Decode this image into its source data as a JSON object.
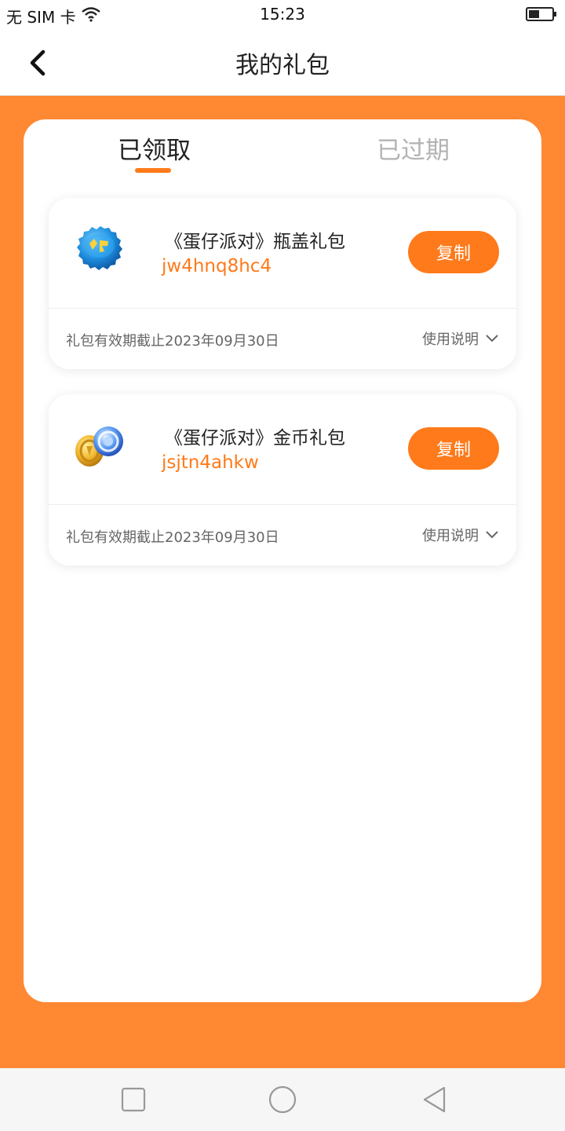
{
  "status_bar": {
    "carrier": "无 SIM 卡",
    "time": "15:23",
    "battery_level": 0.45
  },
  "nav": {
    "title": "我的礼包"
  },
  "tabs": [
    {
      "label": "已领取",
      "active": true
    },
    {
      "label": "已过期",
      "active": false
    }
  ],
  "gifts": [
    {
      "name": "《蛋仔派对》瓶盖礼包",
      "code": "jw4hnq8hc4",
      "copy_label": "复制",
      "expiry": "礼包有效期截止2023年09月30日",
      "usage_label": "使用说明",
      "icon": "bottle-cap-icon"
    },
    {
      "name": "《蛋仔派对》金币礼包",
      "code": "jsjtn4ahkw",
      "copy_label": "复制",
      "expiry": "礼包有效期截止2023年09月30日",
      "usage_label": "使用说明",
      "icon": "gold-coin-icon"
    }
  ],
  "colors": {
    "accent": "#ff7a1a",
    "page_bg": "#ff8833",
    "tab_inactive": "#b3b3b3"
  }
}
